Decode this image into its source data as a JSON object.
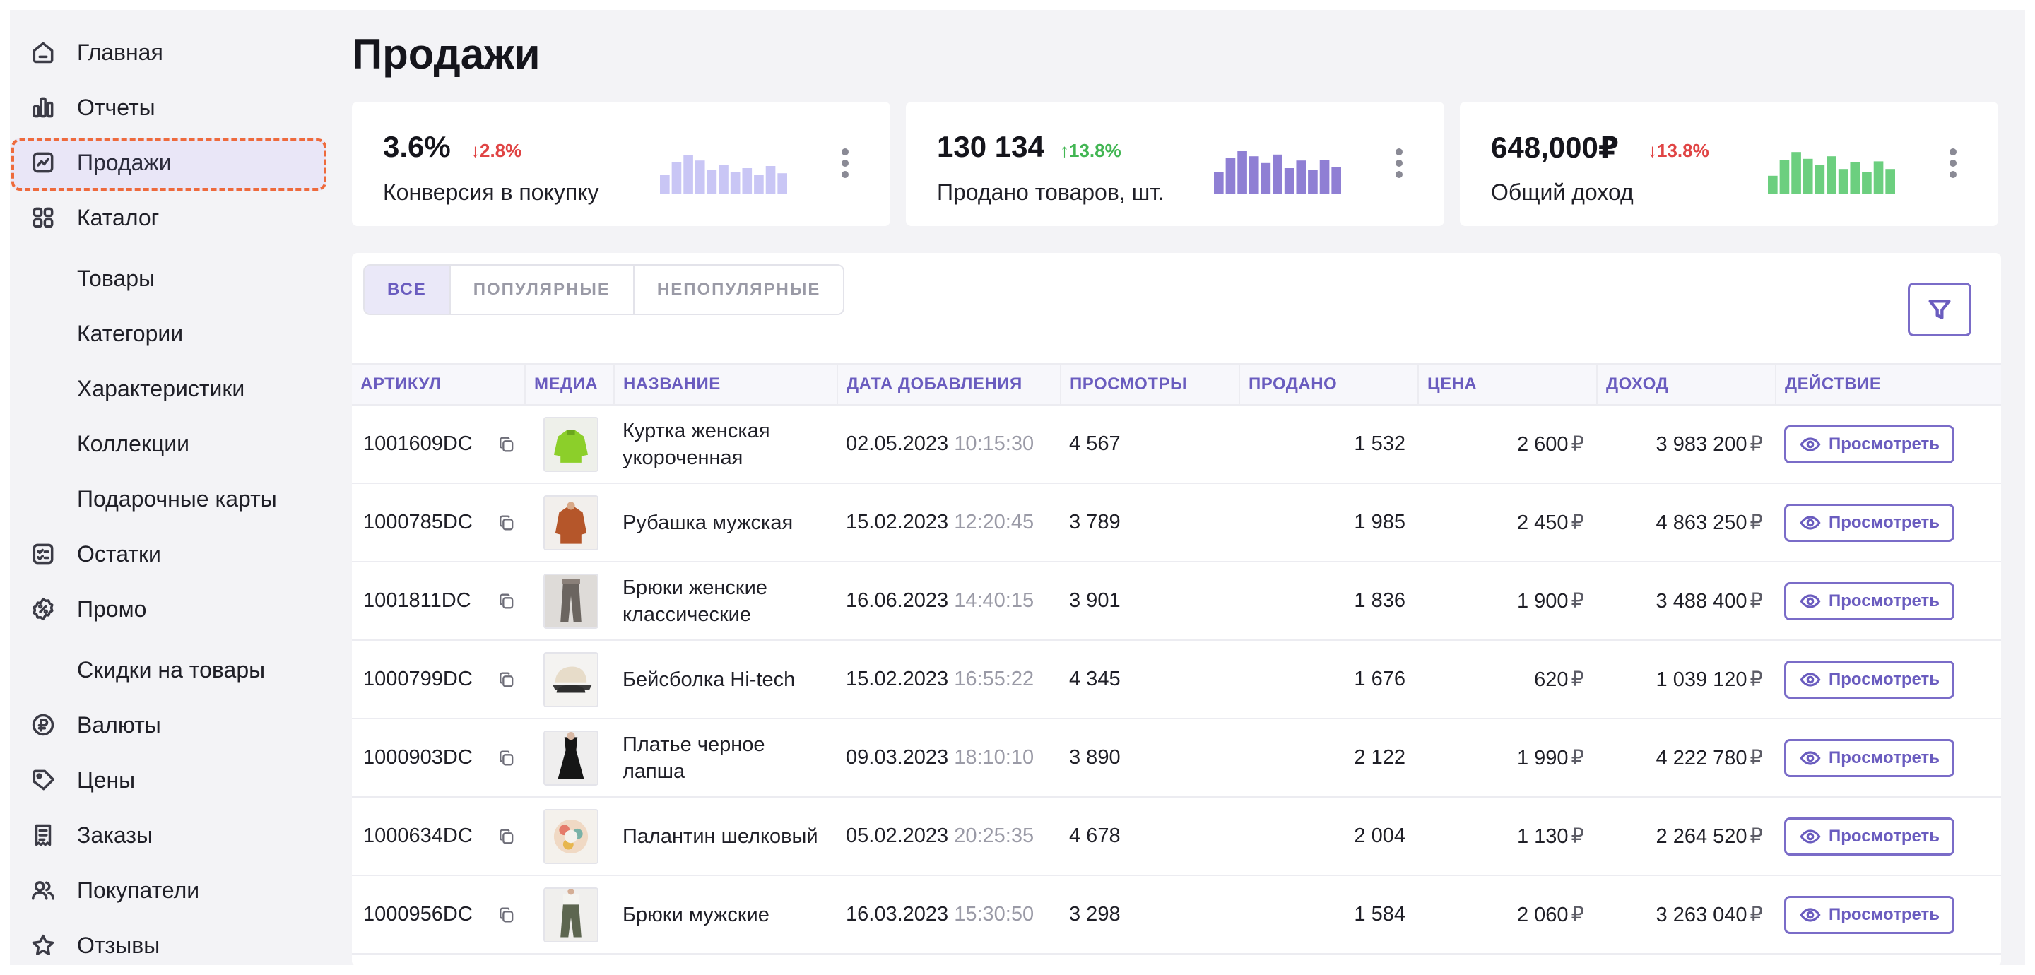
{
  "sidebar": {
    "items": [
      {
        "label": "Главная",
        "icon": "home-icon"
      },
      {
        "label": "Отчеты",
        "icon": "bar-chart-icon"
      },
      {
        "label": "Продажи",
        "icon": "sales-chart-icon",
        "active": true
      },
      {
        "label": "Каталог",
        "icon": "grid-icon"
      },
      {
        "label": "Товары"
      },
      {
        "label": "Категории"
      },
      {
        "label": "Характеристики"
      },
      {
        "label": "Коллекции"
      },
      {
        "label": "Подарочные карты"
      },
      {
        "label": "Остатки",
        "icon": "checklist-icon"
      },
      {
        "label": "Промо",
        "icon": "percent-badge-icon"
      },
      {
        "label": "Скидки на товары"
      },
      {
        "label": "Валюты",
        "icon": "ruble-coin-icon"
      },
      {
        "label": "Цены",
        "icon": "price-tag-icon"
      },
      {
        "label": "Заказы",
        "icon": "receipt-icon"
      },
      {
        "label": "Покупатели",
        "icon": "users-icon"
      },
      {
        "label": "Отзывы",
        "icon": "star-icon"
      }
    ]
  },
  "page": {
    "title": "Продажи"
  },
  "stats": [
    {
      "value": "3.6%",
      "delta": "2.8%",
      "direction": "down",
      "label": "Конверсия в покупку",
      "chart_color": "#c9c6f5",
      "bars": [
        0.45,
        0.75,
        0.9,
        0.78,
        0.55,
        0.68,
        0.5,
        0.6,
        0.45,
        0.65,
        0.48
      ]
    },
    {
      "value": "130 134",
      "delta": "13.8%",
      "direction": "up",
      "label": "Продано товаров, шт.",
      "chart_color": "#8f7fd4",
      "bars": [
        0.5,
        0.85,
        1.0,
        0.88,
        0.72,
        0.92,
        0.6,
        0.78,
        0.55,
        0.8,
        0.62
      ]
    },
    {
      "value": "648,000₽",
      "delta": "13.8%",
      "direction": "down",
      "label": "Общий доход",
      "chart_color": "#6ccf7f",
      "bars": [
        0.42,
        0.8,
        0.98,
        0.82,
        0.68,
        0.88,
        0.58,
        0.74,
        0.5,
        0.76,
        0.58
      ]
    }
  ],
  "tabs": [
    "ВСЕ",
    "ПОПУЛЯРНЫЕ",
    "НЕПОПУЛЯРНЫЕ"
  ],
  "table": {
    "columns": [
      "АРТИКУЛ",
      "МЕДИА",
      "НАЗВАНИЕ",
      "ДАТА ДОБАВЛЕНИЯ",
      "ПРОСМОТРЫ",
      "ПРОДАНО",
      "ЦЕНА",
      "ДОХОД",
      "ДЕЙСТВИЕ"
    ],
    "currency": "₽",
    "action_label": "Просмотреть",
    "rows": [
      {
        "sku": "1001609DC",
        "image": "green-jacket",
        "name": "Куртка женская укороченная",
        "date": "02.05.2023",
        "time": "10:15:30",
        "views": "4 567",
        "sold": "1 532",
        "price": "2 600",
        "revenue": "3 983 200"
      },
      {
        "sku": "1000785DC",
        "image": "brown-shirt",
        "name": "Рубашка мужская",
        "date": "15.02.2023",
        "time": "12:20:45",
        "views": "3 789",
        "sold": "1 985",
        "price": "2 450",
        "revenue": "4 863 250"
      },
      {
        "sku": "1001811DC",
        "image": "trousers-women",
        "name": "Брюки женские классические",
        "date": "16.06.2023",
        "time": "14:40:15",
        "views": "3 901",
        "sold": "1 836",
        "price": "1 900",
        "revenue": "3 488 400"
      },
      {
        "sku": "1000799DC",
        "image": "caps",
        "name": "Бейсболка Hi-tech",
        "date": "15.02.2023",
        "time": "16:55:22",
        "views": "4 345",
        "sold": "1 676",
        "price": "620",
        "revenue": "1 039 120"
      },
      {
        "sku": "1000903DC",
        "image": "black-dress",
        "name": "Платье черное лапша",
        "date": "09.03.2023",
        "time": "18:10:10",
        "views": "3 890",
        "sold": "2 122",
        "price": "1 990",
        "revenue": "4 222 780"
      },
      {
        "sku": "1000634DC",
        "image": "silk-scarf",
        "name": "Палантин шелковый",
        "date": "05.02.2023",
        "time": "20:25:35",
        "views": "4 678",
        "sold": "2 004",
        "price": "1 130",
        "revenue": "2 264 520"
      },
      {
        "sku": "1000956DC",
        "image": "trousers-men",
        "name": "Брюки мужские",
        "date": "16.03.2023",
        "time": "15:30:50",
        "views": "3 298",
        "sold": "1 584",
        "price": "2 060",
        "revenue": "3 263 040"
      }
    ]
  }
}
